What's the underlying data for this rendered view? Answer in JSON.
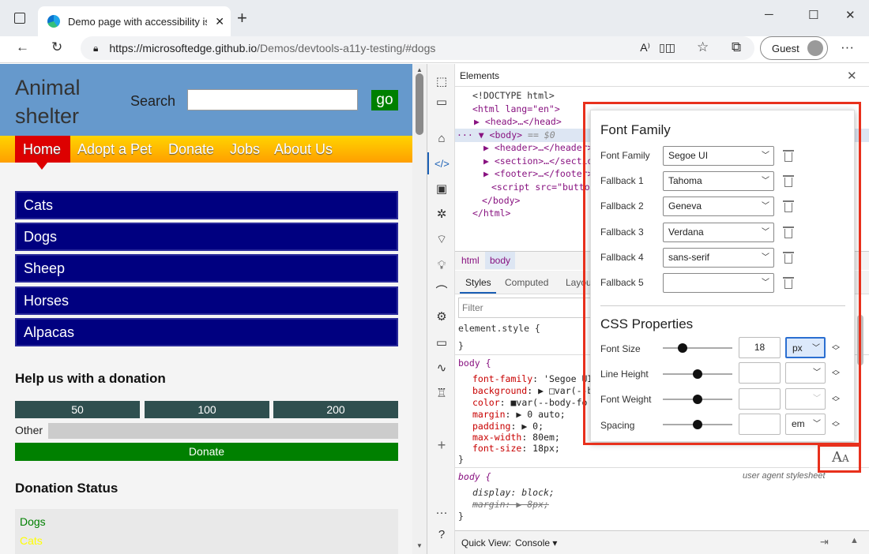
{
  "browser": {
    "tab_title": "Demo page with accessibility issu",
    "new_tab": "+",
    "url_host": "https://microsoftedge.github.io",
    "url_path": "/Demos/devtools-a11y-testing/#dogs",
    "profile_label": "Guest",
    "icons": [
      "tab-actions-icon",
      "edge-logo-icon",
      "close-icon",
      "minimize-icon",
      "maximize-icon",
      "back-icon",
      "refresh-icon",
      "lock-icon",
      "read-aloud-icon",
      "immersive-reader-icon",
      "favorites-icon",
      "collections-icon",
      "more-icon"
    ]
  },
  "page": {
    "logo_line1": "Animal",
    "logo_line2": "shelter",
    "search_label": "Search",
    "go_button": "go",
    "menu": [
      "Home",
      "Adopt a Pet",
      "Donate",
      "Jobs",
      "About Us"
    ],
    "animals": [
      "Cats",
      "Dogs",
      "Sheep",
      "Horses",
      "Alpacas"
    ],
    "donation_heading": "Help us with a donation",
    "donation_amounts": [
      "50",
      "100",
      "200"
    ],
    "other_label": "Other",
    "donate_button": "Donate",
    "status_heading": "Donation Status",
    "status_items": [
      "Dogs",
      "Cats"
    ],
    "colors": {
      "header": "#6699cc",
      "nav_item": "#000080",
      "donate": "#008000",
      "amount": "#2f4f4f",
      "home": "#dd0000",
      "cats_text": "#ffff00",
      "dogs_text": "#008000"
    }
  },
  "devtools": {
    "panel_title": "Elements",
    "dom": {
      "l1": "<!DOCTYPE html>",
      "l2": "<html lang=\"en\">",
      "l3": "▶ <head>…</head>",
      "l4a": "··· ▼ <body>",
      "l4b": " == $0",
      "l5": "▶ <header>…</header>",
      "l6": "▶ <section>…</section>",
      "l7": "▶ <footer>…</footer>",
      "l8": "<script src=\"button",
      "l9": "</body>",
      "l10": "</html>"
    },
    "breadcrumbs": [
      "html",
      "body"
    ],
    "style_tabs": [
      "Styles",
      "Computed",
      "Layou"
    ],
    "filter_placeholder": "Filter",
    "element_style": "element.style {",
    "close_brace": "}",
    "body_rule": {
      "selector": "body {",
      "lines": [
        {
          "p": "font-family",
          "v": "'Segoe UI"
        },
        {
          "p": "background",
          "v": "▶ □var(--b"
        },
        {
          "p": "color",
          "v": "■var(--body-fo"
        },
        {
          "p": "margin",
          "v": "▶ 0 auto;"
        },
        {
          "p": "padding",
          "v": "▶ 0;"
        },
        {
          "p": "max-width",
          "v": "80em;"
        },
        {
          "p": "font-size",
          "v": "18px;"
        }
      ]
    },
    "ua_rule": {
      "selector": "body {",
      "source": "user agent stylesheet",
      "l1": "display: block;",
      "l2": "margin: ▶ 8px;"
    },
    "quick_view_label": "Quick View:",
    "quick_view_value": "Console"
  },
  "font_editor": {
    "family_heading": "Font Family",
    "family_rows": [
      {
        "label": "Font Family",
        "value": "Segoe UI"
      },
      {
        "label": "Fallback 1",
        "value": "Tahoma"
      },
      {
        "label": "Fallback 2",
        "value": "Geneva"
      },
      {
        "label": "Fallback 3",
        "value": "Verdana"
      },
      {
        "label": "Fallback 4",
        "value": "sans-serif"
      },
      {
        "label": "Fallback 5",
        "value": ""
      }
    ],
    "css_heading": "CSS Properties",
    "prop_rows": [
      {
        "label": "Font Size",
        "value": "18",
        "unit": "px"
      },
      {
        "label": "Line Height",
        "value": "",
        "unit": ""
      },
      {
        "label": "Font Weight",
        "value": "",
        "unit": ""
      },
      {
        "label": "Spacing",
        "value": "",
        "unit": "em"
      }
    ]
  }
}
